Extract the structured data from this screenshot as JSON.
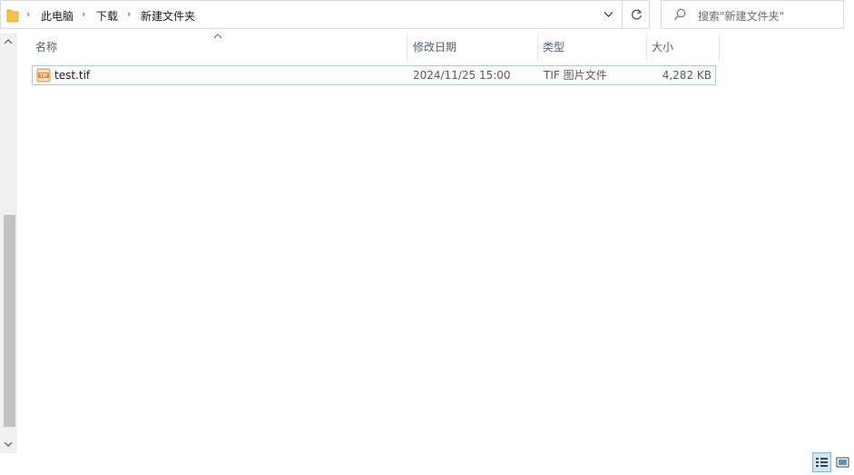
{
  "address": {
    "crumbs": [
      "此电脑",
      "下载",
      "新建文件夹"
    ]
  },
  "search": {
    "placeholder": "搜索\"新建文件夹\""
  },
  "columns": {
    "name": "名称",
    "date": "修改日期",
    "type": "类型",
    "size": "大小"
  },
  "files": [
    {
      "name": "test.tif",
      "date": "2024/11/25 15:00",
      "type": "TIF 图片文件",
      "size": "4,282 KB",
      "icon": "tif-file-icon"
    }
  ],
  "colors": {
    "selection_border": "#99d1ff",
    "header_text": "#4c607a",
    "folder": "#f5c341",
    "tif_icon": "#e98a2b"
  }
}
